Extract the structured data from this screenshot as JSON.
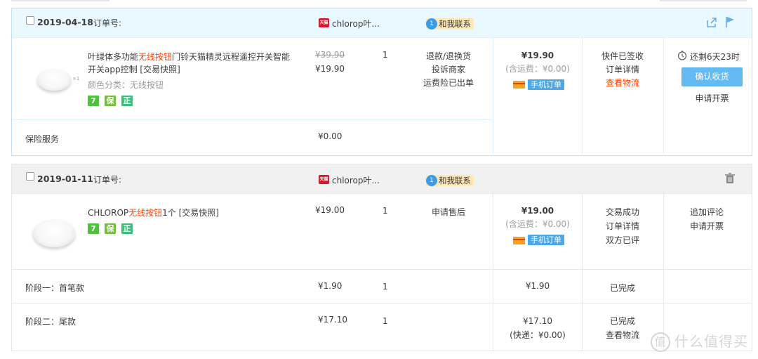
{
  "orders": [
    {
      "date": "2019-04-18",
      "order_no_label": "订单号:",
      "shop_name": "chlorop叶...",
      "tmall_badge": "天猫",
      "contact_label": "和我联系",
      "product": {
        "title_pre": "叶绿体多功能",
        "title_red": "无线按钮",
        "title_post": "门铃天猫精灵远程遥控开关智能",
        "title_line2": "开关app控制 [交易快照]",
        "variant": "颜色分类：无线按钮",
        "badges": [
          "7",
          "保",
          "正"
        ],
        "original_price": "¥39.90",
        "price": "¥19.90",
        "quantity": "1",
        "after_sale": [
          "退款/退换货",
          "投诉商家",
          "运费险已出单"
        ]
      },
      "total": "¥19.90",
      "shipping_note": "(含运费：¥0.00)",
      "mobile_tag": "手机订单",
      "status": [
        "快件已签收",
        "订单详情"
      ],
      "status_red": "查看物流",
      "countdown": "还剩6天23时",
      "confirm_button": "确认收货",
      "invoice_link": "申请开票",
      "insurance": {
        "label": "保险服务",
        "price": "¥0.00"
      }
    },
    {
      "date": "2019-01-11",
      "order_no_label": "订单号:",
      "shop_name": "chlorop叶...",
      "tmall_badge": "天猫",
      "contact_label": "和我联系",
      "product": {
        "title_pre": "CHLOROP",
        "title_red": "无线按钮",
        "title_post": "1个 [交易快照]",
        "badges": [
          "7",
          "保",
          "正"
        ],
        "price": "¥19.00",
        "quantity": "1",
        "after_sale": [
          "申请售后"
        ]
      },
      "total": "¥19.00",
      "shipping_note": "(含运费：¥0.00)",
      "mobile_tag": "手机订单",
      "status": [
        "交易成功",
        "订单详情",
        "双方已评"
      ],
      "actions": [
        "追加评论",
        "申请开票"
      ],
      "stages": [
        {
          "label": "阶段一：首笔款",
          "price": "¥1.90",
          "quantity": "1",
          "amount": "¥1.90",
          "status": "已完成"
        },
        {
          "label": "阶段二：尾款",
          "price": "¥17.10",
          "quantity": "1",
          "amount": "¥17.10",
          "amount_note": "(快递：¥0.00)",
          "status": "已完成",
          "status2": "查看物流"
        }
      ]
    }
  ],
  "watermark": "什么值得买",
  "watermark_icon": "值"
}
